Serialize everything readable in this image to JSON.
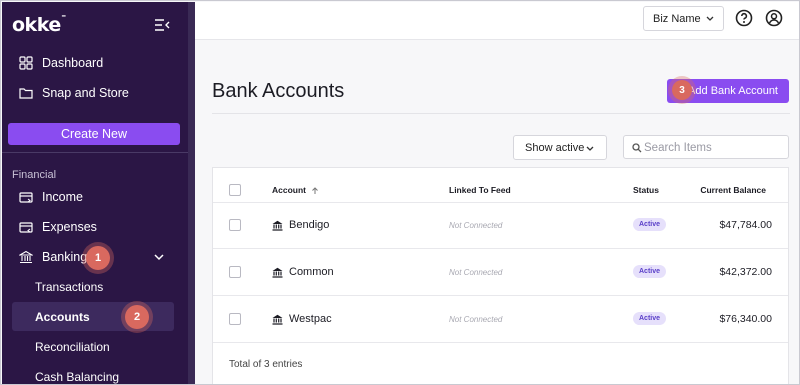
{
  "app": {
    "logo": "okke",
    "logo_mark": "˗"
  },
  "sidebar": {
    "items_top": [
      {
        "label": "Dashboard",
        "icon": "grid-icon"
      },
      {
        "label": "Snap and Store",
        "icon": "folder-icon"
      }
    ],
    "create_label": "Create New",
    "section_label": "Financial",
    "items_financial": [
      {
        "label": "Income",
        "icon": "income-icon"
      },
      {
        "label": "Expenses",
        "icon": "expenses-icon"
      },
      {
        "label": "Banking",
        "icon": "bank-icon",
        "expanded": true
      }
    ],
    "banking_sub": [
      {
        "label": "Transactions"
      },
      {
        "label": "Accounts",
        "active": true
      },
      {
        "label": "Reconciliation"
      },
      {
        "label": "Cash Balancing"
      }
    ]
  },
  "topbar": {
    "business_select": "Biz Name",
    "help_icon": "help-icon",
    "account_icon": "user-icon"
  },
  "page": {
    "title": "Bank Accounts",
    "add_button": "Add Bank Account",
    "filter_select": "Show active",
    "search_placeholder": "Search Items"
  },
  "table": {
    "columns": [
      "Account",
      "Linked To Feed",
      "Status",
      "Current Balance"
    ],
    "rows": [
      {
        "account": "Bendigo",
        "linked": "Not Connected",
        "status": "Active",
        "balance": "$47,784.00"
      },
      {
        "account": "Common",
        "linked": "Not Connected",
        "status": "Active",
        "balance": "$42,372.00"
      },
      {
        "account": "Westpac",
        "linked": "Not Connected",
        "status": "Active",
        "balance": "$76,340.00"
      }
    ],
    "footer": "Total of 3 entries"
  },
  "annotations": [
    "1",
    "2",
    "3"
  ],
  "colors": {
    "sidebar_bg": "#2b1645",
    "accent": "#8a4cf0",
    "badge": "#d9695f",
    "status_bg": "#e6e0fb",
    "status_text": "#5a3fc8"
  }
}
